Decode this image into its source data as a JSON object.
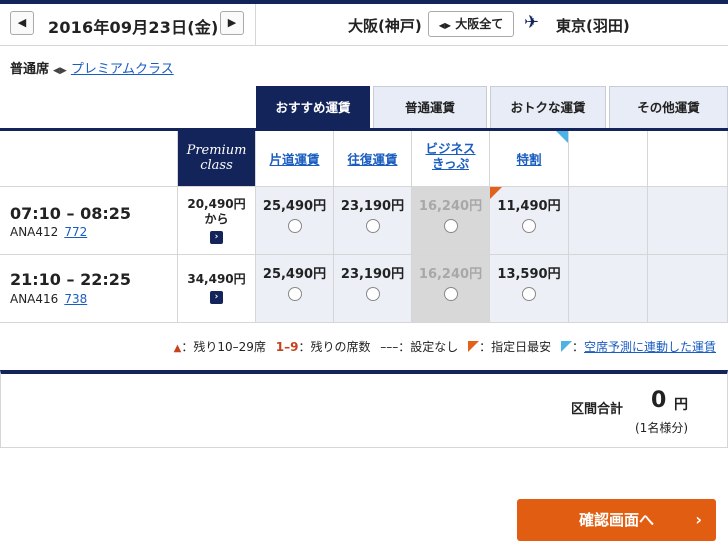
{
  "header": {
    "date": "2016年09月23日(金)",
    "origin": "大阪(神戸)",
    "all_airports_label": "大阪全て",
    "destination": "東京(羽田)"
  },
  "seat_class": {
    "current": "普通席",
    "alt_link": "プレミアムクラス"
  },
  "tabs": [
    {
      "label": "おすすめ運賃",
      "active": true
    },
    {
      "label": "普通運賃"
    },
    {
      "label": "おトクな運賃"
    },
    {
      "label": "その他運賃"
    }
  ],
  "columns": {
    "premium_line1": "Premium",
    "premium_line2": "class",
    "fare_types": [
      "片道運賃",
      "往復運賃",
      "ビジネス\nきっぷ",
      "特割"
    ]
  },
  "flights": [
    {
      "time": "07:10 – 08:25",
      "flight_no": "ANA412",
      "aircraft": "772",
      "premium_price": "20,490円",
      "premium_suffix": "から",
      "fares": [
        "25,490円",
        "23,190円",
        "16,240円",
        "11,490円"
      ]
    },
    {
      "time": "21:10 – 22:25",
      "flight_no": "ANA416",
      "aircraft": "738",
      "premium_price": "34,490円",
      "premium_suffix": "",
      "fares": [
        "25,490円",
        "23,190円",
        "16,240円",
        "13,590円"
      ]
    }
  ],
  "legend": {
    "few_seats": "：残り10–29席",
    "range": "1–9",
    "remaining": "：残りの席数",
    "dashes": "–––",
    "not_set": "：設定なし",
    "cheapest": "：指定日最安",
    "linked": "空席予測に連動した運賃"
  },
  "total": {
    "label": "区間合計",
    "amount": "0",
    "unit": "円",
    "persons": "(1名様分)"
  },
  "confirm_button": "確認画面へ",
  "colors": {
    "navy": "#13245a",
    "orange": "#e05d12",
    "link": "#1a5dc0"
  }
}
